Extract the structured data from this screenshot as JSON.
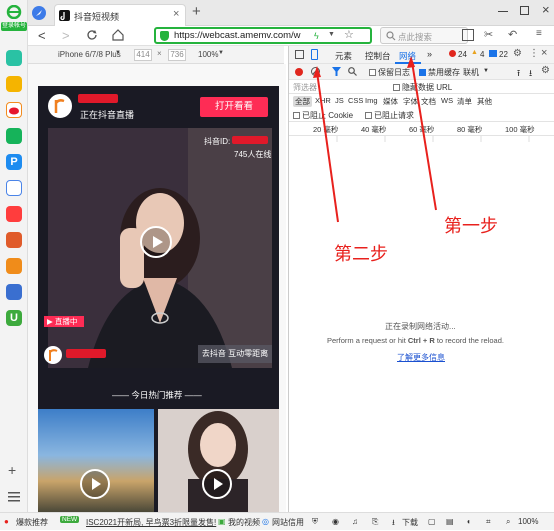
{
  "left_sidebar": {
    "login_label": "登录帐号",
    "apps": [
      "wifi",
      "star",
      "weibo",
      "mail",
      "p-app",
      "doc",
      "video",
      "game-1",
      "game-2",
      "game-3",
      "u-app"
    ]
  },
  "tabs": [
    {
      "title": "抖音短视频"
    }
  ],
  "toolbar": {
    "url": "https://webcast.amemv.com/w",
    "search_placeholder": "点此搜索"
  },
  "device_toolbar": {
    "device": "iPhone 6/7/8 Plus",
    "width": "414",
    "times": "×",
    "height": "736",
    "zoom": "100%"
  },
  "phone": {
    "live_title": "正在抖音直播",
    "open_button": "打开看看",
    "douyin_id_label": "抖音ID:",
    "viewers": "745人在线",
    "live_badge": "直播中",
    "interact_button": "去抖音 互动零距离",
    "recommend_heading": "—— 今日热门推荐 ——"
  },
  "devtools": {
    "tabs": [
      "元素",
      "控制台",
      "网络",
      "»"
    ],
    "active_tab": "网络",
    "errors": "24",
    "warnings": "4",
    "messages": "22",
    "preserve_log": "保留日志",
    "disable_cache": "禁用缓存",
    "throttle": "联机",
    "filter_placeholder": "筛选器",
    "hide_data_urls": "隐藏数据 URL",
    "type_filters": [
      "全部",
      "XHR",
      "JS",
      "CSS",
      "Img",
      "媒体",
      "字体",
      "文档",
      "WS",
      "清单",
      "其他"
    ],
    "blocked_cookie": "已阻止 Cookie",
    "blocked_request": "已阻止请求",
    "timeline": [
      "20 毫秒",
      "40 毫秒",
      "60 毫秒",
      "80 毫秒",
      "100 毫秒"
    ],
    "recording_text": "正在录制网络活动...",
    "hint_pre": "Perform a request or hit ",
    "hint_key": "Ctrl + R",
    "hint_post": " to record the reload.",
    "learn_more": "了解更多信息"
  },
  "annotations": {
    "step1": "第一步",
    "step2": "第二步"
  },
  "statusbar": {
    "hot_rec": "爆款推荐",
    "news_badge": "NEW",
    "news": "ISC2021开新局, 早鸟票3折限量发售!",
    "my_video": "我的视频",
    "site_credit": "网站信用",
    "download": "下载",
    "zoom": "100%"
  },
  "colors": {
    "accent_green": "#25b33d",
    "douyin_red": "#fe2c55",
    "annotation_red": "#e8211d"
  }
}
